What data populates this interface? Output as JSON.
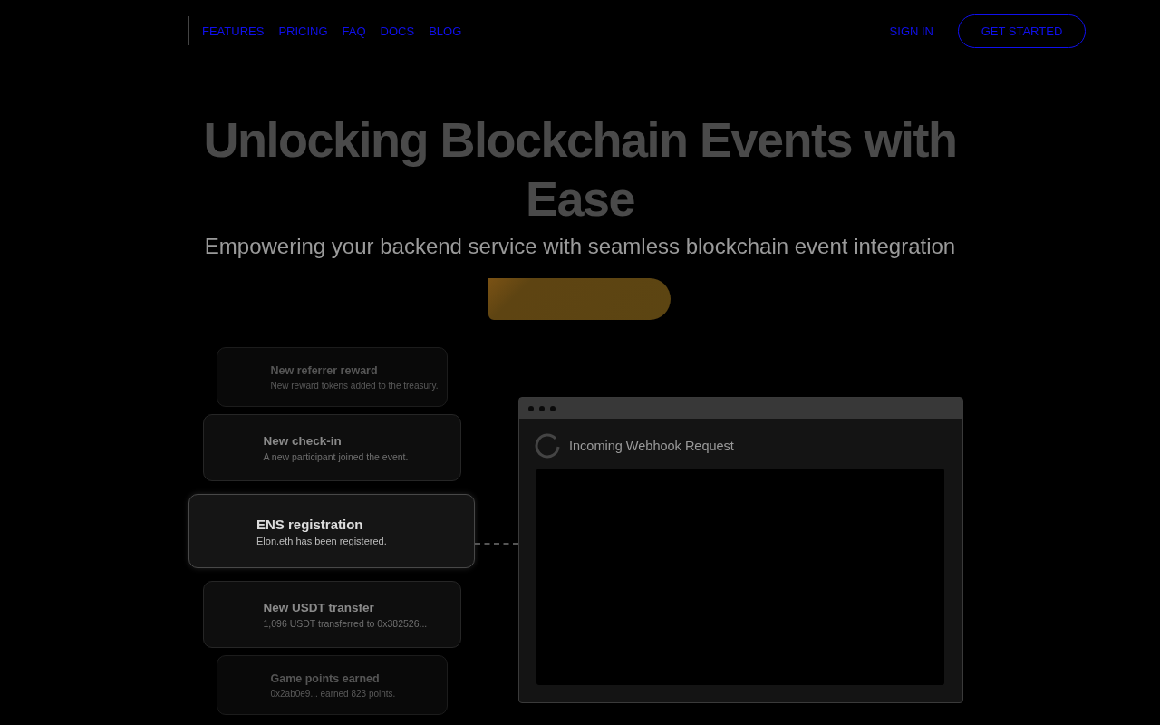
{
  "nav": {
    "links": [
      "FEATURES",
      "PRICING",
      "FAQ",
      "DOCS",
      "BLOG"
    ],
    "sign_in": "SIGN IN",
    "get_started": "GET STARTED"
  },
  "hero": {
    "title": "Unlocking Blockchain Events with Ease",
    "subtitle": "Empowering your backend service with seamless blockchain event integration"
  },
  "events": [
    {
      "title": "New referrer reward",
      "description": "New reward tokens added to the treasury.",
      "selected": false
    },
    {
      "title": "New check-in",
      "description": "A new participant joined the event.",
      "selected": false
    },
    {
      "title": "ENS registration",
      "description": "Elon.eth has been registered.",
      "selected": true
    },
    {
      "title": "New USDT transfer",
      "description": "1,096 USDT transferred to 0x382526...",
      "selected": false
    },
    {
      "title": "Game points earned",
      "description": "0x2ab0e9... earned 823 points.",
      "selected": false
    }
  ],
  "webhook": {
    "title": "Incoming Webhook Request"
  }
}
